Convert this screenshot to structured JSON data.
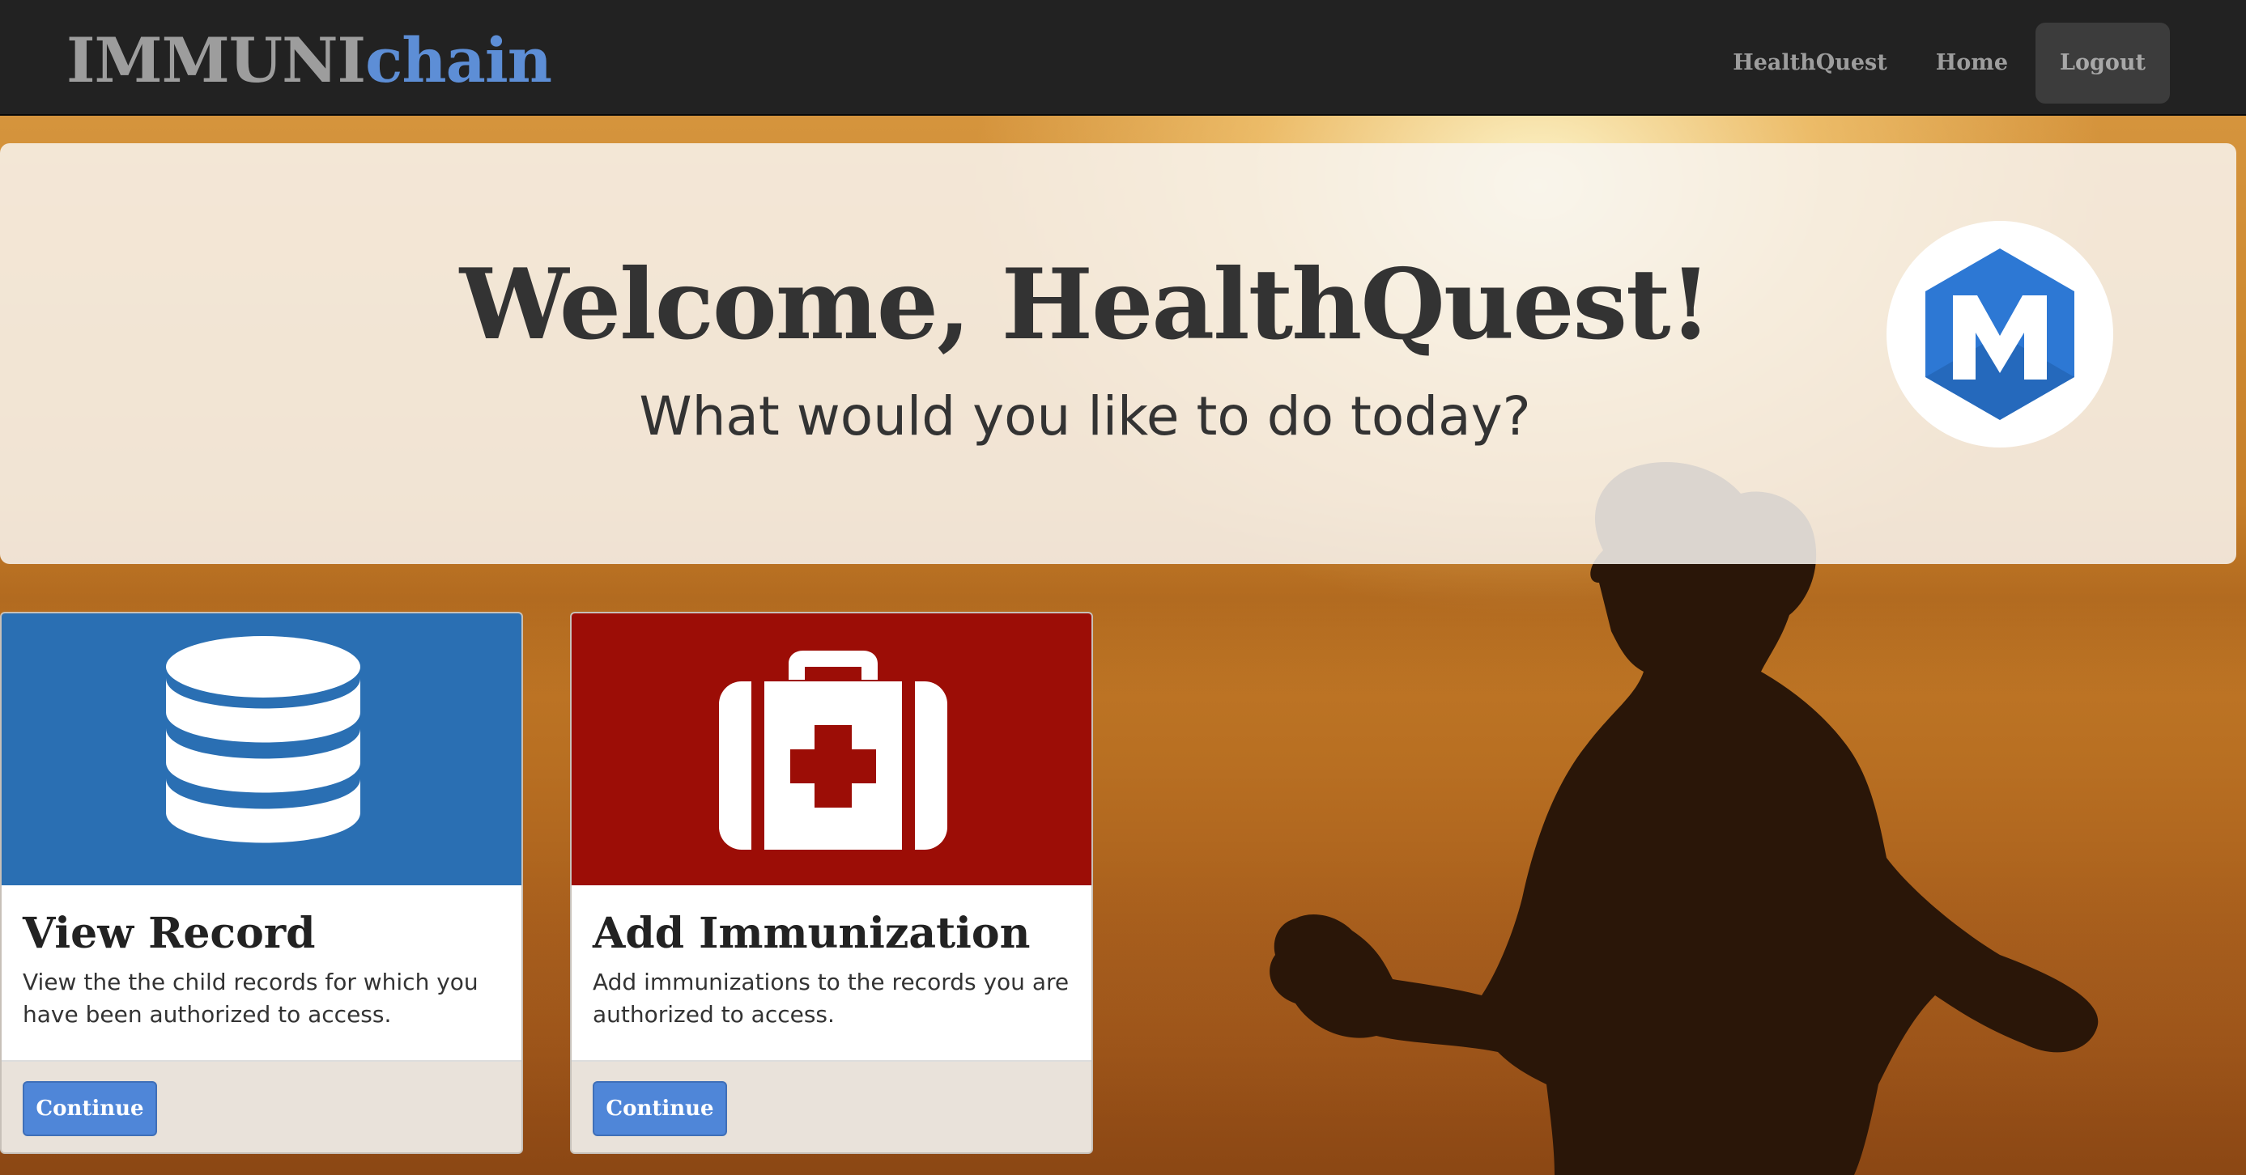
{
  "brand": {
    "part1": "IMMUNI",
    "part2": "chain"
  },
  "nav": {
    "items": [
      "HealthQuest",
      "Home"
    ],
    "logout": "Logout"
  },
  "jumbotron": {
    "heading": "Welcome, HealthQuest!",
    "subheading": "What would you like to do today?",
    "logo_letter": "M"
  },
  "cards": [
    {
      "icon": "database-icon",
      "color": "#2a6fb3",
      "title": "View Record",
      "description": "View the the child records for which you have been authorized to access.",
      "button": "Continue"
    },
    {
      "icon": "first-aid-kit-icon",
      "color": "#9c0d06",
      "title": "Add Immunization",
      "description": "Add immunizations to the records you are authorized to access.",
      "button": "Continue"
    }
  ],
  "colors": {
    "navbar": "#222222",
    "brand_accent": "#5d8ed6",
    "button": "#4f86d8"
  }
}
